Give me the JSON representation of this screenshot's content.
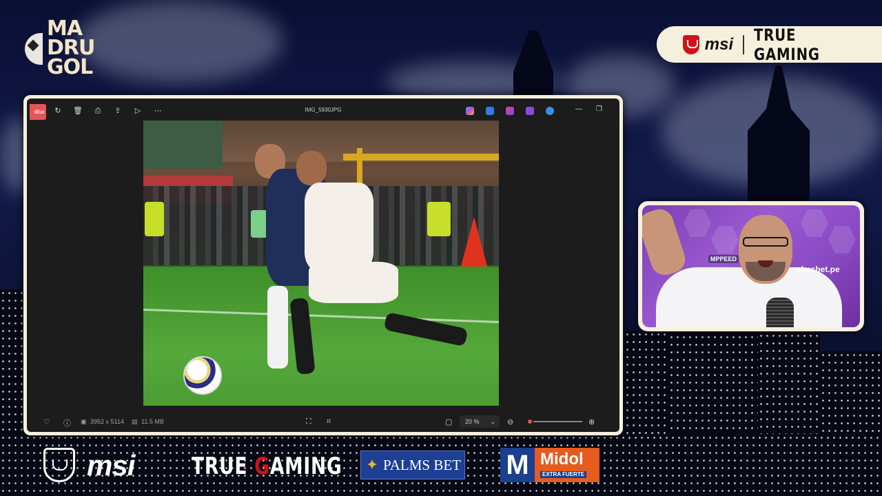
{
  "brand": {
    "line1": "MA",
    "line2": "DRU",
    "line3": "GOL"
  },
  "top_sponsor": {
    "msi": "msi",
    "tagline": "TRUE GAMING"
  },
  "photos_app": {
    "edit_label": "ditar",
    "file_name": "IMG_5930JPG",
    "dimensions": "3952 x 5114",
    "file_size": "11.5 MB",
    "zoom": "20 %",
    "zoom_level": 0.05,
    "toolbar_icons": [
      "rotate-icon",
      "delete-icon",
      "print-icon",
      "share-icon",
      "slideshow-icon",
      "more-icon"
    ],
    "app_icons": [
      "copilot-icon",
      "designer-icon",
      "clipchamp-icon",
      "app-icon",
      "onedrive-icon"
    ]
  },
  "webcam": {
    "badge": "MPPEED",
    "watermark": "almsbet.pe"
  },
  "sponsors": {
    "msi": "msi",
    "true_gaming_prefix": "TRUE ",
    "true_gaming_g": "G",
    "true_gaming_suffix": "AMING",
    "palms": "PALMS BET",
    "midol_m": "M",
    "midol_name": "Midol",
    "midol_sub": "EXTRA FUERTE"
  },
  "colors": {
    "accent_red": "#d0121b",
    "frame": "#f6f0de",
    "photos_accent": "#e25558",
    "palms_blue": "#1d3f94",
    "midol_orange": "#e65b1e"
  }
}
